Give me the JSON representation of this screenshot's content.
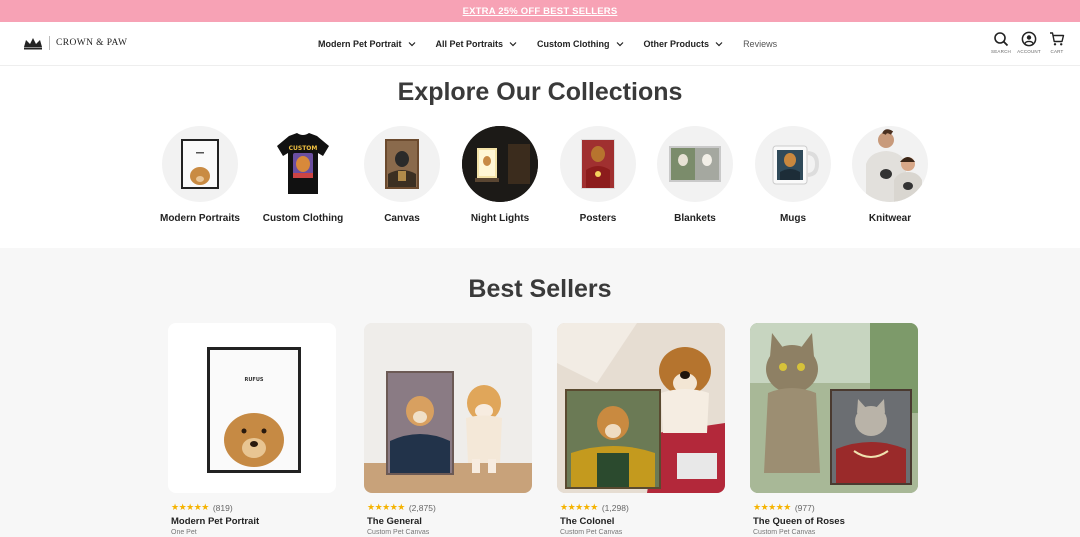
{
  "promo": {
    "text": "EXTRA 25% OFF BEST SELLERS"
  },
  "header": {
    "brand": "CROWN & PAW",
    "nav": [
      {
        "label": "Modern Pet Portrait",
        "dropdown": true
      },
      {
        "label": "All Pet Portraits",
        "dropdown": true
      },
      {
        "label": "Custom Clothing",
        "dropdown": true
      },
      {
        "label": "Other Products",
        "dropdown": true
      },
      {
        "label": "Reviews",
        "dropdown": false
      }
    ],
    "tools": [
      {
        "label": "SEARCH",
        "icon": "search-icon"
      },
      {
        "label": "ACCOUNT",
        "icon": "account-icon"
      },
      {
        "label": "CART",
        "icon": "cart-icon"
      }
    ]
  },
  "collections": {
    "title": "Explore Our Collections",
    "items": [
      {
        "label": "Modern Portraits"
      },
      {
        "label": "Custom Clothing",
        "shirt_text": "CUSTOM"
      },
      {
        "label": "Canvas"
      },
      {
        "label": "Night Lights"
      },
      {
        "label": "Posters"
      },
      {
        "label": "Blankets"
      },
      {
        "label": "Mugs"
      },
      {
        "label": "Knitwear"
      }
    ]
  },
  "bestsellers": {
    "title": "Best Sellers",
    "products": [
      {
        "name": "Modern Pet Portrait",
        "subtitle": "One Pet",
        "stars": "★★★★★",
        "reviews": "(819)",
        "frame_text": "RUFUS"
      },
      {
        "name": "The General",
        "subtitle": "Custom Pet Canvas",
        "stars": "★★★★★",
        "reviews": "(2,875)"
      },
      {
        "name": "The Colonel",
        "subtitle": "Custom Pet Canvas",
        "stars": "★★★★★",
        "reviews": "(1,298)"
      },
      {
        "name": "The Queen of Roses",
        "subtitle": "Custom Pet Canvas",
        "stars": "★★★★★",
        "reviews": "(977)"
      }
    ]
  },
  "colors": {
    "promo_bg": "#f7a2b5",
    "star": "#f5b301",
    "section_bg": "#f7f7f7"
  }
}
